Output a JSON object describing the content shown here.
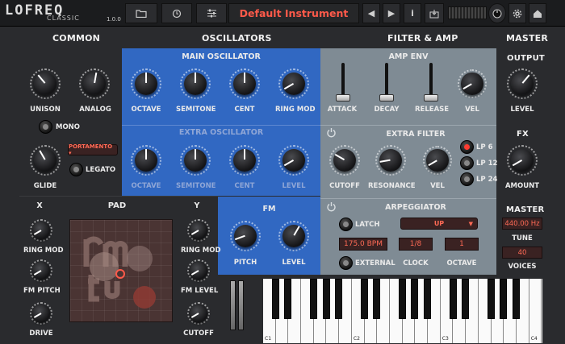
{
  "app": {
    "logo_text": "LOFREQ",
    "logo_sub": "CLASSIC",
    "version": "1.0.0",
    "preset_name": "Default Instrument"
  },
  "toolbar": {
    "prev": "◀",
    "next": "▶",
    "info": "i"
  },
  "sections": {
    "common": "COMMON",
    "oscillators": "OSCILLATORS",
    "filter_amp": "FILTER & AMP",
    "master": "MASTER",
    "main_osc": "MAIN OSCILLATOR",
    "extra_osc": "EXTRA OSCILLATOR",
    "amp_env": "AMP ENV",
    "extra_filter": "EXTRA FILTER",
    "arpeggiator": "ARPEGGIATOR",
    "fm": "FM",
    "pad": "PAD",
    "output": "OUTPUT",
    "fx": "FX",
    "master2": "MASTER"
  },
  "common": {
    "unison": "UNISON",
    "analog": "ANALOG",
    "mono": "MONO",
    "portamento": "PORTAMENTO ▾",
    "legato": "LEGATO",
    "glide": "GLIDE"
  },
  "main_osc": {
    "octave": "OCTAVE",
    "semitone": "SEMITONE",
    "cent": "CENT",
    "ring_mod": "RING MOD"
  },
  "extra_osc": {
    "octave": "OCTAVE",
    "semitone": "SEMITONE",
    "cent": "CENT",
    "level": "LEVEL"
  },
  "amp_env": {
    "attack": "ATTACK",
    "decay": "DECAY",
    "release": "RELEASE",
    "vel": "VEL"
  },
  "extra_filter": {
    "lp6": "LP 6",
    "lp12": "LP 12",
    "lp24": "LP 24",
    "cutoff": "CUTOFF",
    "resonance": "RESONANCE",
    "vel": "VEL"
  },
  "arp": {
    "latch": "LATCH",
    "mode": "UP",
    "bpm": "175.0 BPM",
    "clock_value": "1/8",
    "octave_value": "1",
    "external": "EXTERNAL",
    "clock": "CLOCK",
    "octave": "OCTAVE"
  },
  "fm": {
    "pitch": "PITCH",
    "level": "LEVEL"
  },
  "pad": {
    "x": "X",
    "y": "Y",
    "ring_mod_l": "RING MOD",
    "fm_pitch": "FM PITCH",
    "drive": "DRIVE",
    "ring_mod_r": "RING MOD",
    "fm_level": "FM LEVEL",
    "cutoff": "CUTOFF"
  },
  "output": {
    "level": "LEVEL"
  },
  "fx": {
    "amount": "AMOUNT"
  },
  "master": {
    "tune_value": "440.00 Hz",
    "tune": "TUNE",
    "voices_value": "40",
    "voices": "VOICES"
  },
  "keyboard": {
    "c1": "C1",
    "c2": "C2",
    "c3": "C3",
    "c4": "C4"
  },
  "colors": {
    "accent": "#ff5a4a",
    "blue_panel": "#3168c2",
    "gray_panel": "#7f8b94"
  }
}
